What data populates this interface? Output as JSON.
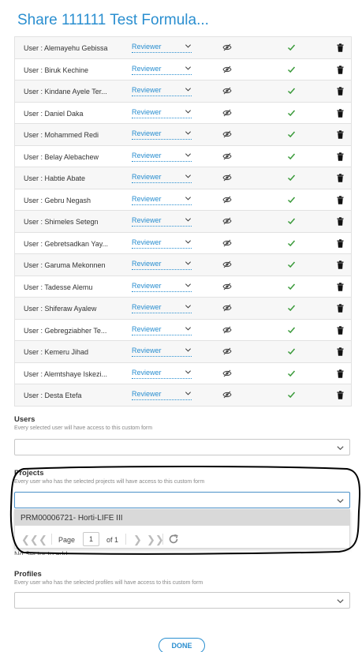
{
  "header": {
    "title": "Share 111111 Test Formula..."
  },
  "users": [
    {
      "name": "User : Alemayehu Gebissa",
      "role": "Reviewer"
    },
    {
      "name": "User : Biruk Kechine",
      "role": "Reviewer"
    },
    {
      "name": "User : Kindane Ayele Ter...",
      "role": "Reviewer"
    },
    {
      "name": "User : Daniel Daka",
      "role": "Reviewer"
    },
    {
      "name": "User : Mohammed Redi",
      "role": "Reviewer"
    },
    {
      "name": "User : Belay Alebachew",
      "role": "Reviewer"
    },
    {
      "name": "User : Habtie Abate",
      "role": "Reviewer"
    },
    {
      "name": "User : Gebru Negash",
      "role": "Reviewer"
    },
    {
      "name": "User : Shimeles Setegn",
      "role": "Reviewer"
    },
    {
      "name": "User : Gebretsadkan Yay...",
      "role": "Reviewer"
    },
    {
      "name": "User : Garuma Mekonnen",
      "role": "Reviewer"
    },
    {
      "name": "User : Tadesse Alemu",
      "role": "Reviewer"
    },
    {
      "name": "User : Shiferaw Ayalew",
      "role": "Reviewer"
    },
    {
      "name": "User : Gebregziabher Te...",
      "role": "Reviewer"
    },
    {
      "name": "User : Kemeru Jihad",
      "role": "Reviewer"
    },
    {
      "name": "User : Alemtshaye Iskezi...",
      "role": "Reviewer"
    },
    {
      "name": "User : Desta Etefa",
      "role": "Reviewer"
    }
  ],
  "users_section": {
    "label": "Users",
    "hint": "Every selected user will have access to this custom form"
  },
  "projects_section": {
    "label": "Projects",
    "hint": "Every user who has the selected projects will have access to this custom form",
    "dropdown_item": "PRM00006721- Horti-LIFE III",
    "pager": {
      "page_label": "Page",
      "page_value": "1",
      "of_label": "of 1"
    }
  },
  "sectors_hidden_text": "No Sector to add",
  "profiles_section": {
    "label": "Profiles",
    "hint": "Every user who has the selected profiles will have access to this custom form"
  },
  "footer": {
    "done_label": "DONE"
  },
  "colors": {
    "accent": "#2b8fd0",
    "check": "#3a9a3a",
    "annotation": "#000000"
  },
  "icons": [
    "eye-off-icon",
    "check-icon",
    "trash-icon",
    "chevron-down-icon",
    "first-page-icon",
    "prev-page-icon",
    "next-page-icon",
    "last-page-icon",
    "refresh-icon"
  ]
}
